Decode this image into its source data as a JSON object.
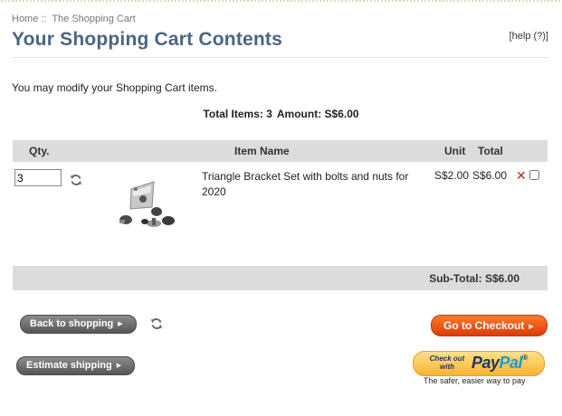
{
  "breadcrumb": {
    "home": "Home",
    "separator": "::",
    "current": "The Shopping Cart"
  },
  "page": {
    "title": "Your Shopping Cart Contents",
    "help": "[help (?)]"
  },
  "intro": "You may modify your Shopping Cart items.",
  "totals": {
    "items_label": "Total Items: 3",
    "amount_label": "Amount: S$6.00"
  },
  "cart": {
    "headers": {
      "qty": "Qty.",
      "item_name": "Item Name",
      "unit": "Unit",
      "total": "Total"
    },
    "items": [
      {
        "qty": "3",
        "name": "Triangle Bracket Set with bolts and nuts for 2020",
        "unit_price": "S$2.00",
        "total": "S$6.00",
        "remove_symbol": "✕",
        "remove_checked": false
      }
    ],
    "subtotal": "Sub-Total: S$6.00"
  },
  "buttons": {
    "back_to_shopping": "Back to shopping",
    "estimate_shipping": "Estimate shipping",
    "go_to_checkout": "Go to Checkout",
    "arrow": "▶"
  },
  "paypal": {
    "checkout_text": "Check out with",
    "brand_a": "Pay",
    "brand_b": "Pal",
    "registered": "®",
    "tagline": "The safer, easier way to pay"
  },
  "icons": {
    "refresh": "refresh-icon",
    "remove": "remove-icon"
  },
  "colors": {
    "title": "#4a6583",
    "accent_orange": "#dd3a05",
    "remove_red": "#b32a17",
    "bar_gray": "#dcdcdc"
  }
}
